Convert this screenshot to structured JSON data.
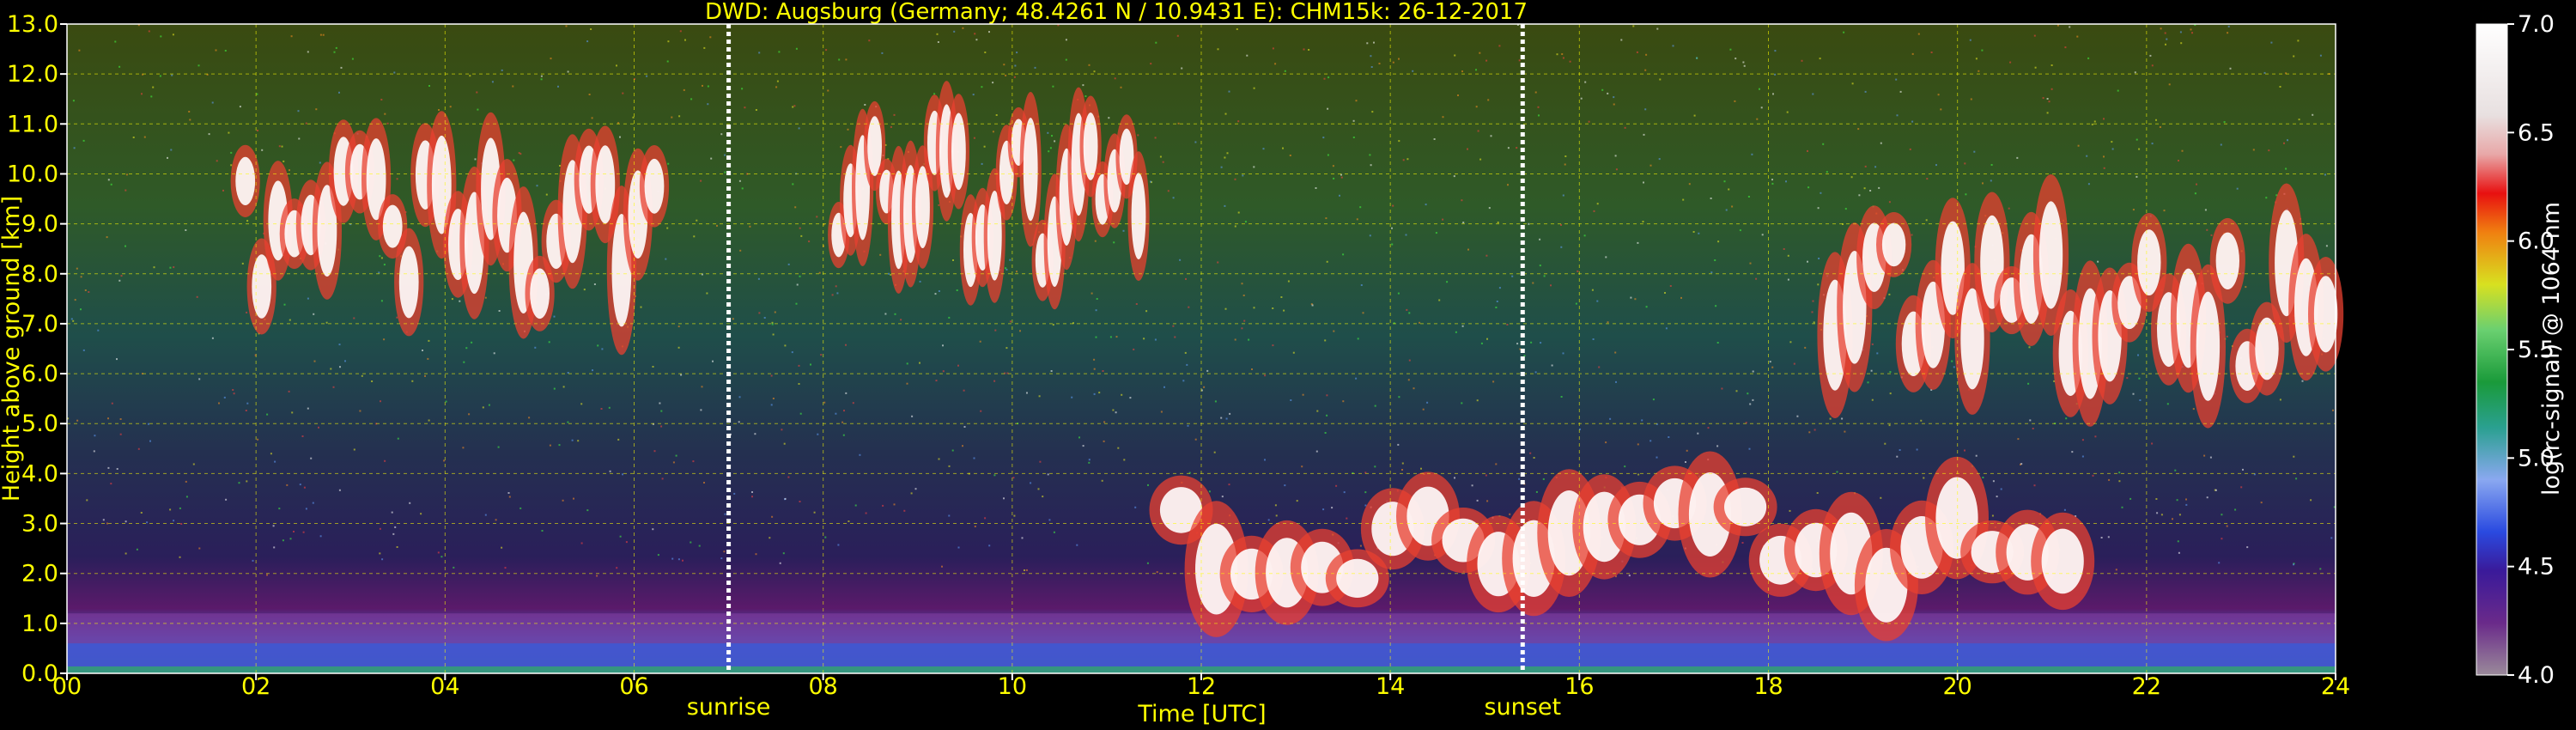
{
  "chart_data": {
    "type": "heatmap",
    "title": "DWD: Augsburg (Germany; 48.4261 N / 10.9431 E):    CHM15k: 26-12-2017",
    "xlabel": "Time [UTC]",
    "ylabel": "Height above ground [km]",
    "x_ticks": [
      "00",
      "02",
      "04",
      "06",
      "08",
      "10",
      "12",
      "14",
      "16",
      "18",
      "20",
      "22",
      "24"
    ],
    "y_ticks": [
      "0.0",
      "1.0",
      "2.0",
      "3.0",
      "4.0",
      "5.0",
      "6.0",
      "7.0",
      "8.0",
      "9.0",
      "10.0",
      "11.0",
      "12.0",
      "13.0"
    ],
    "xlim": [
      0,
      24
    ],
    "ylim": [
      0,
      13
    ],
    "grid": true,
    "markers": [
      {
        "label": "sunrise",
        "hour": 7.0
      },
      {
        "label": "sunset",
        "hour": 15.4
      }
    ],
    "colorbar": {
      "label": "log(rc-signal) @ 1064 nm",
      "range": [
        4.0,
        7.0
      ],
      "ticks": [
        "4.0",
        "4.5",
        "5.0",
        "5.5",
        "6.0",
        "6.5",
        "7.0"
      ]
    },
    "features": [
      {
        "name": "boundary-layer aerosol",
        "start_h": 0.0,
        "end_h": 24.0,
        "bottom_km": 0.0,
        "top_km": 1.2
      },
      {
        "name": "cirrus-morning",
        "start_h": 1.8,
        "end_h": 6.3,
        "bottom_km": 7.2,
        "top_km": 10.8
      },
      {
        "name": "cirrus-midday",
        "start_h": 8.1,
        "end_h": 11.4,
        "bottom_km": 7.8,
        "top_km": 11.2
      },
      {
        "name": "mid-level cloud",
        "start_h": 11.6,
        "end_h": 21.3,
        "bottom_km": 1.2,
        "top_km": 4.1
      },
      {
        "name": "cirrus-evening",
        "start_h": 18.6,
        "end_h": 24.0,
        "bottom_km": 5.6,
        "top_km": 9.2
      }
    ]
  }
}
